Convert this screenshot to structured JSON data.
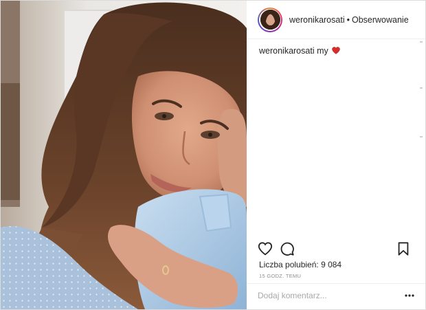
{
  "header": {
    "username": "weronikarosati",
    "separator": "•",
    "follow_label": "Obserwowanie"
  },
  "caption": {
    "username": "weronikarosati",
    "text": "my"
  },
  "likes": {
    "text": "Liczba polubień: 9 084"
  },
  "timestamp": "15 GODZ. TEMU",
  "comment": {
    "placeholder": "Dodaj komentarz..."
  },
  "icons": {
    "like": "heart-outline-icon",
    "comment": "speech-bubble-icon",
    "save": "bookmark-icon",
    "more": "more-options-icon",
    "caption_emoji": "red-heart-icon"
  },
  "colors": {
    "text": "#262626",
    "muted": "#8e8e8e",
    "placeholder": "#a8a8a8",
    "border": "#dbdbdb",
    "heart_emoji": "#d62d2d"
  }
}
